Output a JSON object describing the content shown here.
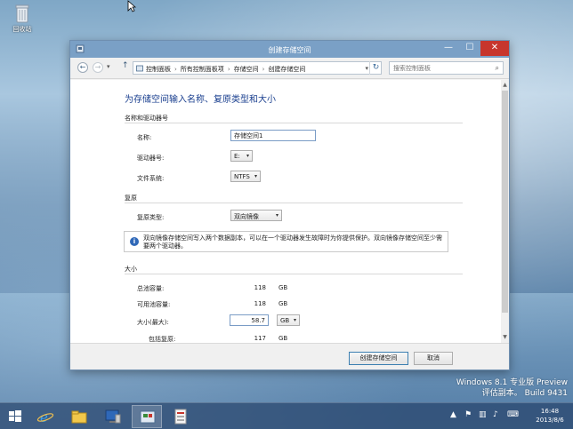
{
  "desktop": {
    "recycle_bin_label": "回收站"
  },
  "window": {
    "title": "创建存储空间",
    "controls": {
      "minimize": "—",
      "maximize": "☐",
      "close": "✕"
    }
  },
  "addressbar": {
    "breadcrumbs": [
      "控制面板",
      "所有控制面板项",
      "存储空间",
      "创建存储空间"
    ],
    "search_placeholder": "搜索控制面板"
  },
  "page": {
    "heading": "为存储空间输入名称、复原类型和大小",
    "name_section": {
      "title": "名称和驱动器号",
      "name_label": "名称:",
      "name_value": "存储空间1",
      "drive_label": "驱动器号:",
      "drive_value": "E:",
      "fs_label": "文件系统:",
      "fs_value": "NTFS"
    },
    "resiliency_section": {
      "title": "复原",
      "type_label": "复原类型:",
      "type_value": "双向镜像",
      "info_text": "双向镜像存储空间写入两个数据副本，可以在一个驱动器发生故障时为你提供保护。双向镜像存储空间至少需要两个驱动器。"
    },
    "size_section": {
      "title": "大小",
      "total_label": "总池容量:",
      "total_value": "118",
      "total_unit": "GB",
      "available_label": "可用池容量:",
      "available_value": "118",
      "available_unit": "GB",
      "max_label": "大小(最大):",
      "max_value": "58.7",
      "max_unit": "GB",
      "incl_label": "包括复原:",
      "incl_value": "117",
      "incl_unit": "GB"
    }
  },
  "footer": {
    "create_label": "创建存储空间",
    "cancel_label": "取消"
  },
  "watermark": {
    "line1": "Windows 8.1 专业版 Preview",
    "line2": "评估副本。 Build 9431"
  },
  "taskbar": {
    "clock_time": "16:48",
    "clock_date": "2013/8/6"
  },
  "colors": {
    "titlebar": "#7aa0c6",
    "heading": "#1a3f8f",
    "close_button": "#c7362d"
  }
}
